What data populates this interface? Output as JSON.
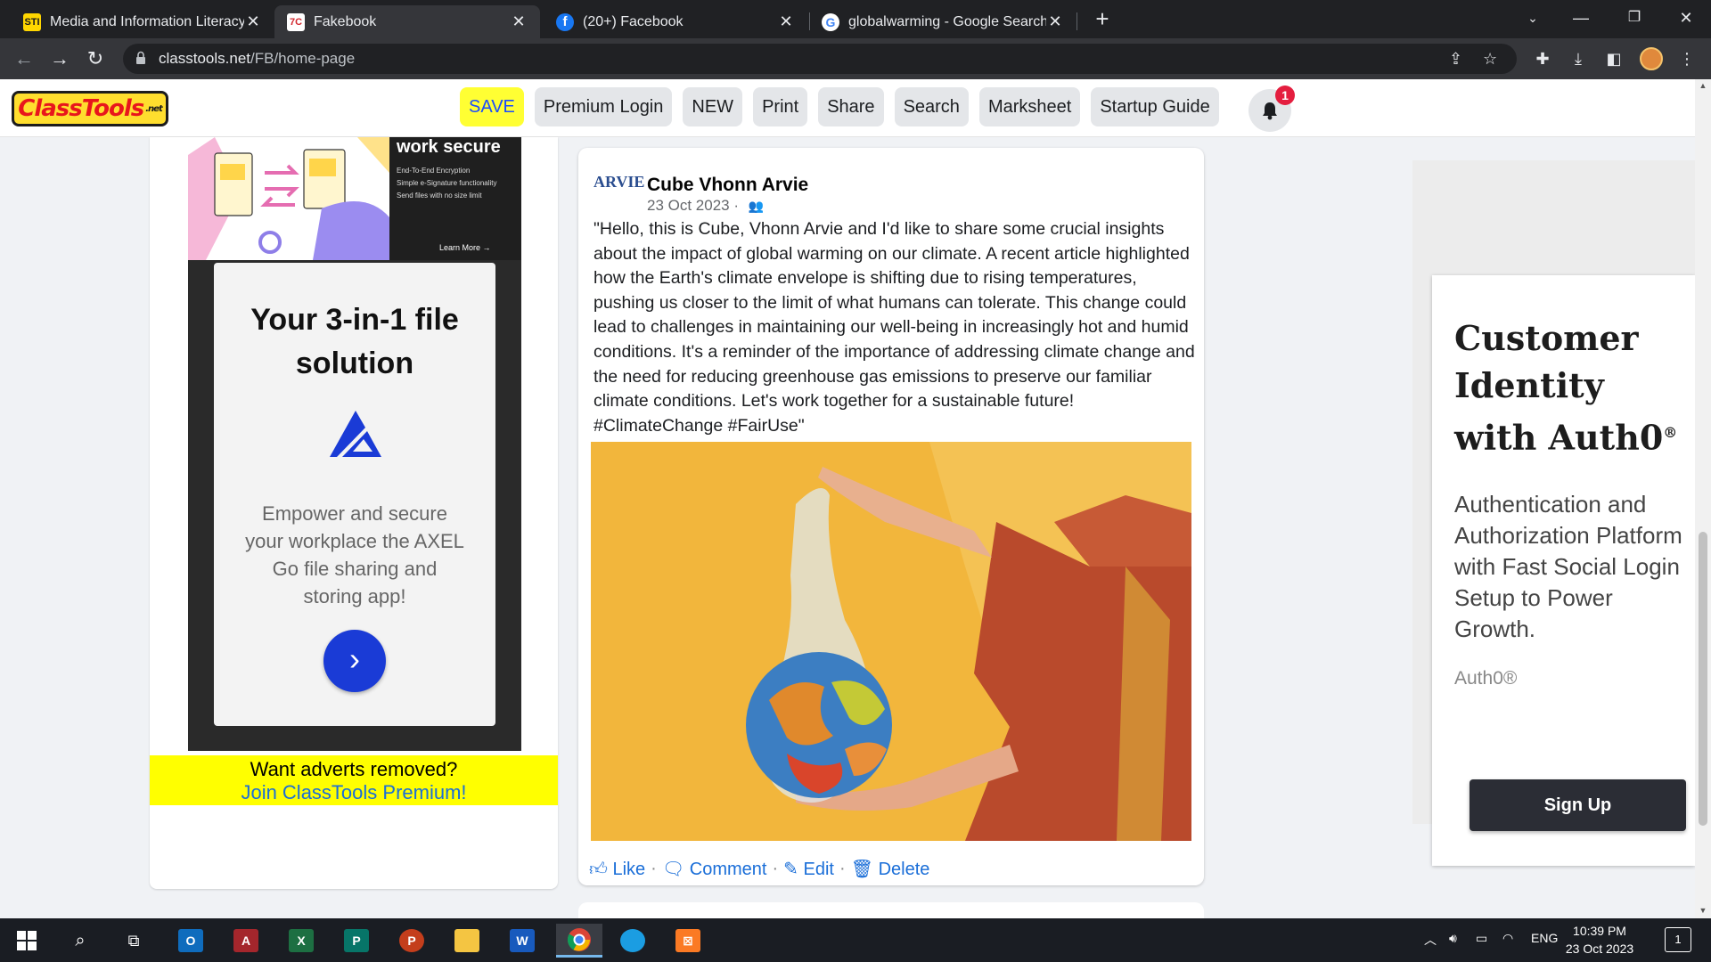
{
  "browser": {
    "tabs": [
      {
        "title": "Media and Information Literacy",
        "favicon": "STI",
        "favicon_color": "#ffd600",
        "active": false
      },
      {
        "title": "Fakebook",
        "favicon": "7C",
        "favicon_color": "#ffffff",
        "active": true
      },
      {
        "title": "(20+) Facebook",
        "favicon": "f",
        "favicon_color": "#1877f2",
        "active": false
      },
      {
        "title": "globalwarming - Google Search",
        "favicon": "G",
        "favicon_color": "#ffffff",
        "active": false
      }
    ],
    "close_glyph": "✕",
    "new_tab": "+",
    "url_domain": "classtools.net",
    "url_path": "/FB/home-page"
  },
  "site": {
    "logo_text": "ClassTools",
    "logo_suffix": ".net",
    "nav": [
      {
        "label": "SAVE"
      },
      {
        "label": "Premium Login"
      },
      {
        "label": "NEW"
      },
      {
        "label": "Print"
      },
      {
        "label": "Share"
      },
      {
        "label": "Search"
      },
      {
        "label": "Marksheet"
      },
      {
        "label": "Startup Guide"
      }
    ],
    "notification_count": "1"
  },
  "left_ad": {
    "banner_heading": "work secure",
    "banner_lines": [
      "End-To-End Encryption",
      "Simple e-Signature functionality",
      "Send files with no size limit"
    ],
    "banner_link": "Learn More",
    "title": "Your 3-in-1 file solution",
    "description": "Empower and secure your workplace the AXEL Go file sharing and storing app!",
    "cta_glyph": "›",
    "premium_line1": "Want adverts removed?",
    "premium_line2": "Join ClassTools Premium!"
  },
  "post": {
    "avatar_text": "ARVIE",
    "author": "Cube Vhonn Arvie",
    "date": "23 Oct 2023",
    "date_separator": "·",
    "body": "\"Hello, this is Cube, Vhonn Arvie and I'd like to share some crucial insights about the impact of global warming on our climate. A recent article highlighted how the Earth's climate envelope is shifting due to rising temperatures, pushing us closer to the limit of what humans can tolerate. This change could lead to challenges in maintaining our well-being in increasingly hot and humid conditions. It's a reminder of the importance of addressing climate change and the need for reducing greenhouse gas emissions to preserve our familiar climate conditions. Let's work together for a sustainable future! #ClimateChange #FairUse\"",
    "actions": [
      {
        "label": "Like",
        "icon": "thumbs-up-icon"
      },
      {
        "label": "Comment",
        "icon": "comment-icon"
      },
      {
        "label": "Edit",
        "icon": "edit-icon"
      },
      {
        "label": "Delete",
        "icon": "trash-icon"
      }
    ],
    "action_separator": "·"
  },
  "right_ad": {
    "title": "Customer Identity with Auth0",
    "title_mark": "®",
    "subtitle": "Authentication and Authorization Platform with Fast Social Login Setup to Power Growth.",
    "brand": "Auth0®",
    "cta": "Sign Up"
  },
  "taskbar": {
    "language": "ENG",
    "time": "10:39 PM",
    "date": "23 Oct 2023",
    "notifications": "1"
  },
  "colors": {
    "save_bg": "#ffff33",
    "save_text": "#1a4bff",
    "link": "#1a6ed8",
    "premium_bg": "#ffff00",
    "photo_bg": "#f2b63c",
    "signup_bg": "#2b2d35"
  }
}
